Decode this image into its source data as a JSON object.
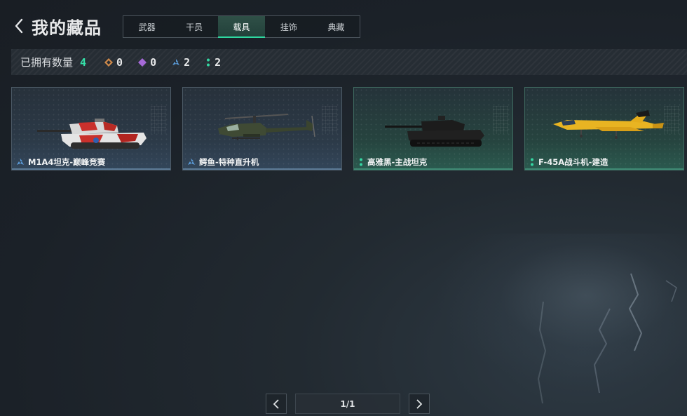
{
  "header": {
    "title": "我的藏品",
    "tabs": [
      {
        "label": "武器",
        "active": false
      },
      {
        "label": "干员",
        "active": false
      },
      {
        "label": "载具",
        "active": true
      },
      {
        "label": "挂饰",
        "active": false
      },
      {
        "label": "典藏",
        "active": false
      }
    ]
  },
  "stats": {
    "label": "已拥有数量",
    "total": "4",
    "rarities": [
      {
        "icon": "orange-diamond-icon",
        "color": "#d08a4a",
        "count": "0"
      },
      {
        "icon": "purple-diamond-icon",
        "color": "#a66ad8",
        "count": "0"
      },
      {
        "icon": "blue-chevron-icon",
        "color": "#5b9bd8",
        "count": "2"
      },
      {
        "icon": "teal-dots-icon",
        "color": "#35d6a2",
        "count": "2"
      }
    ]
  },
  "items": [
    {
      "name": "M1A4坦克-巅峰竞赛",
      "rarity": "blue",
      "icon": "blue-rarity-icon",
      "art": "tank-icon"
    },
    {
      "name": "鳄鱼-特种直升机",
      "rarity": "blue",
      "icon": "blue-rarity-icon",
      "art": "helicopter-icon"
    },
    {
      "name": "高雅黑-主战坦克",
      "rarity": "teal",
      "icon": "teal-rarity-icon",
      "art": "tank-icon"
    },
    {
      "name": "F-45A战斗机-建造",
      "rarity": "teal",
      "icon": "teal-rarity-icon",
      "art": "jet-icon"
    }
  ],
  "pager": {
    "indicator": "1/1"
  },
  "colors": {
    "accent": "#2fd7a0",
    "blue_rarity": "#5b9bd8",
    "teal_rarity": "#35d6a2"
  }
}
